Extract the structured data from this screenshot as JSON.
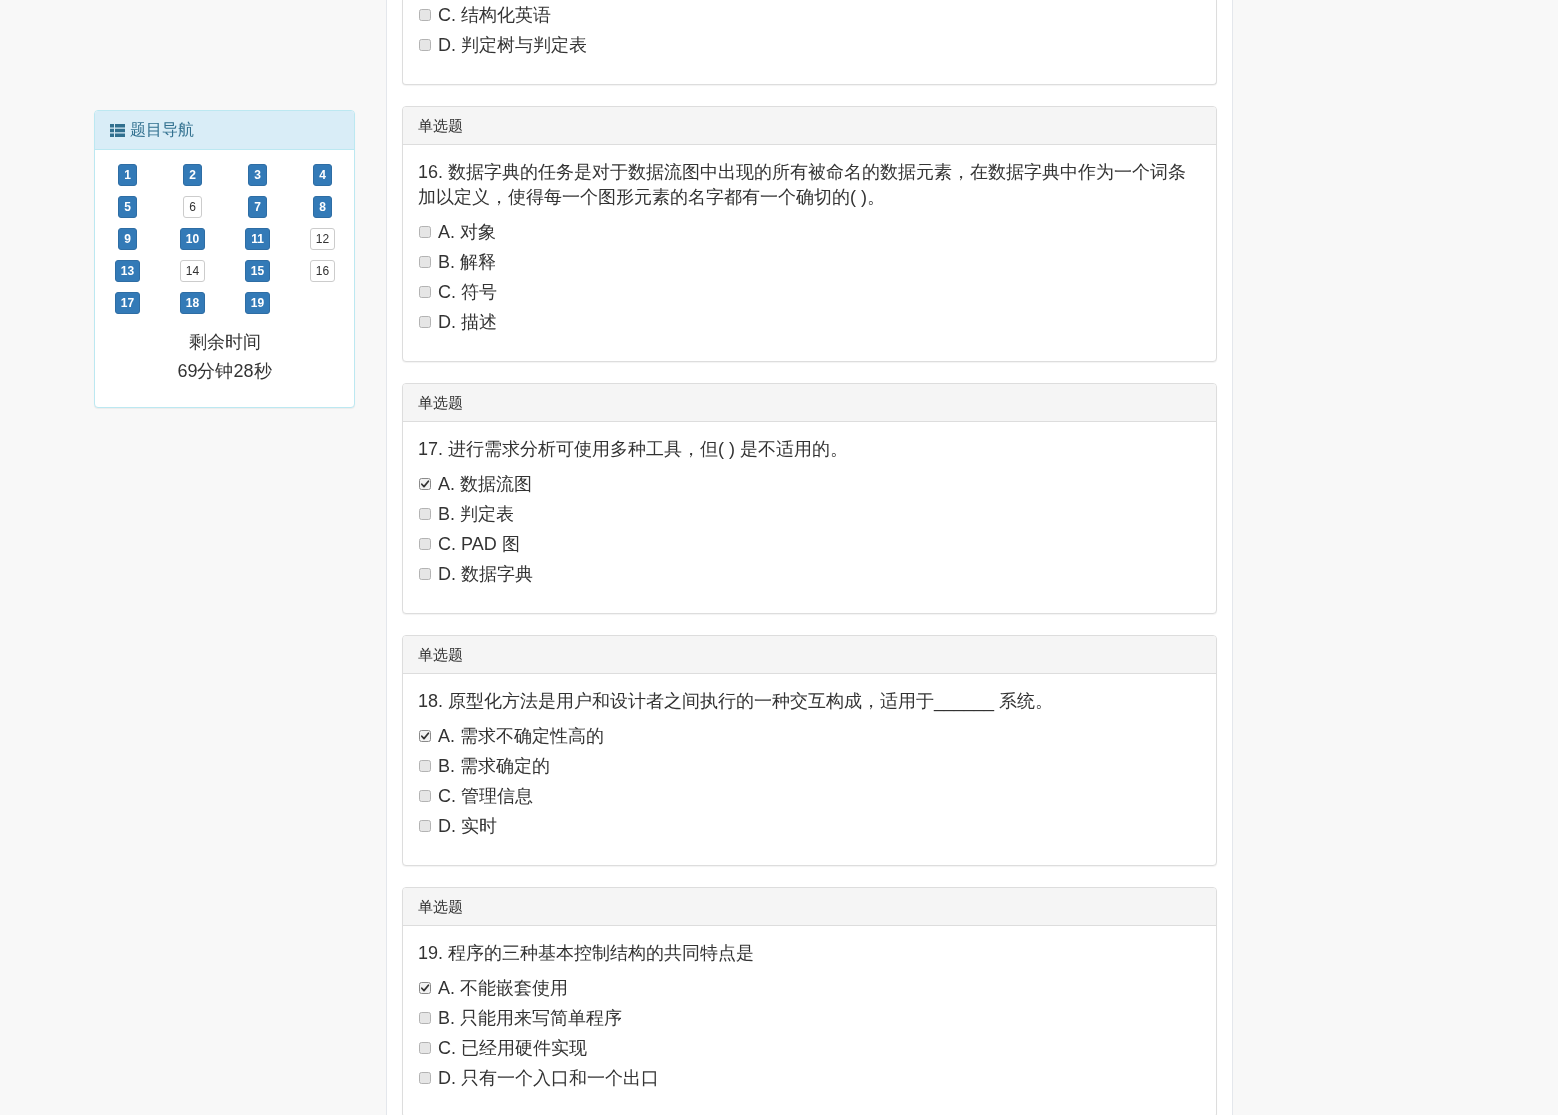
{
  "navigation": {
    "title": "题目导航",
    "items": [
      {
        "label": "1",
        "answered": true
      },
      {
        "label": "2",
        "answered": true
      },
      {
        "label": "3",
        "answered": true
      },
      {
        "label": "4",
        "answered": true
      },
      {
        "label": "5",
        "answered": true
      },
      {
        "label": "6",
        "answered": false
      },
      {
        "label": "7",
        "answered": true
      },
      {
        "label": "8",
        "answered": true
      },
      {
        "label": "9",
        "answered": true
      },
      {
        "label": "10",
        "answered": true
      },
      {
        "label": "11",
        "answered": true
      },
      {
        "label": "12",
        "answered": false
      },
      {
        "label": "13",
        "answered": true
      },
      {
        "label": "14",
        "answered": false
      },
      {
        "label": "15",
        "answered": true
      },
      {
        "label": "16",
        "answered": false
      },
      {
        "label": "17",
        "answered": true
      },
      {
        "label": "18",
        "answered": true
      },
      {
        "label": "19",
        "answered": true
      }
    ],
    "time_label": "剩余时间",
    "time_remaining": "69分钟28秒"
  },
  "partial_question": {
    "options": [
      {
        "label": "C. 结构化英语",
        "checked": false
      },
      {
        "label": "D. 判定树与判定表",
        "checked": false
      }
    ]
  },
  "questions": [
    {
      "type_label": "单选题",
      "text": "16. 数据字典的任务是对于数据流图中出现的所有被命名的数据元素，在数据字典中作为一个词条加以定义，使得每一个图形元素的名字都有一个确切的( )。",
      "options": [
        {
          "label": "A. 对象",
          "checked": false
        },
        {
          "label": "B. 解释",
          "checked": false
        },
        {
          "label": "C. 符号",
          "checked": false
        },
        {
          "label": "D. 描述",
          "checked": false
        }
      ]
    },
    {
      "type_label": "单选题",
      "text": "17. 进行需求分析可使用多种工具，但( ) 是不适用的。",
      "options": [
        {
          "label": "A. 数据流图",
          "checked": true
        },
        {
          "label": "B. 判定表",
          "checked": false
        },
        {
          "label": "C. PAD 图",
          "checked": false
        },
        {
          "label": "D. 数据字典",
          "checked": false
        }
      ]
    },
    {
      "type_label": "单选题",
      "text": "18. 原型化方法是用户和设计者之间执行的一种交互构成，适用于______ 系统。",
      "options": [
        {
          "label": "A. 需求不确定性高的",
          "checked": true
        },
        {
          "label": "B. 需求确定的",
          "checked": false
        },
        {
          "label": "C. 管理信息",
          "checked": false
        },
        {
          "label": "D. 实时",
          "checked": false
        }
      ]
    },
    {
      "type_label": "单选题",
      "text": "19. 程序的三种基本控制结构的共同特点是",
      "options": [
        {
          "label": "A. 不能嵌套使用",
          "checked": true
        },
        {
          "label": "B. 只能用来写简单程序",
          "checked": false
        },
        {
          "label": "C. 已经用硬件实现",
          "checked": false
        },
        {
          "label": "D. 只有一个入口和一个出口",
          "checked": false
        }
      ]
    }
  ]
}
